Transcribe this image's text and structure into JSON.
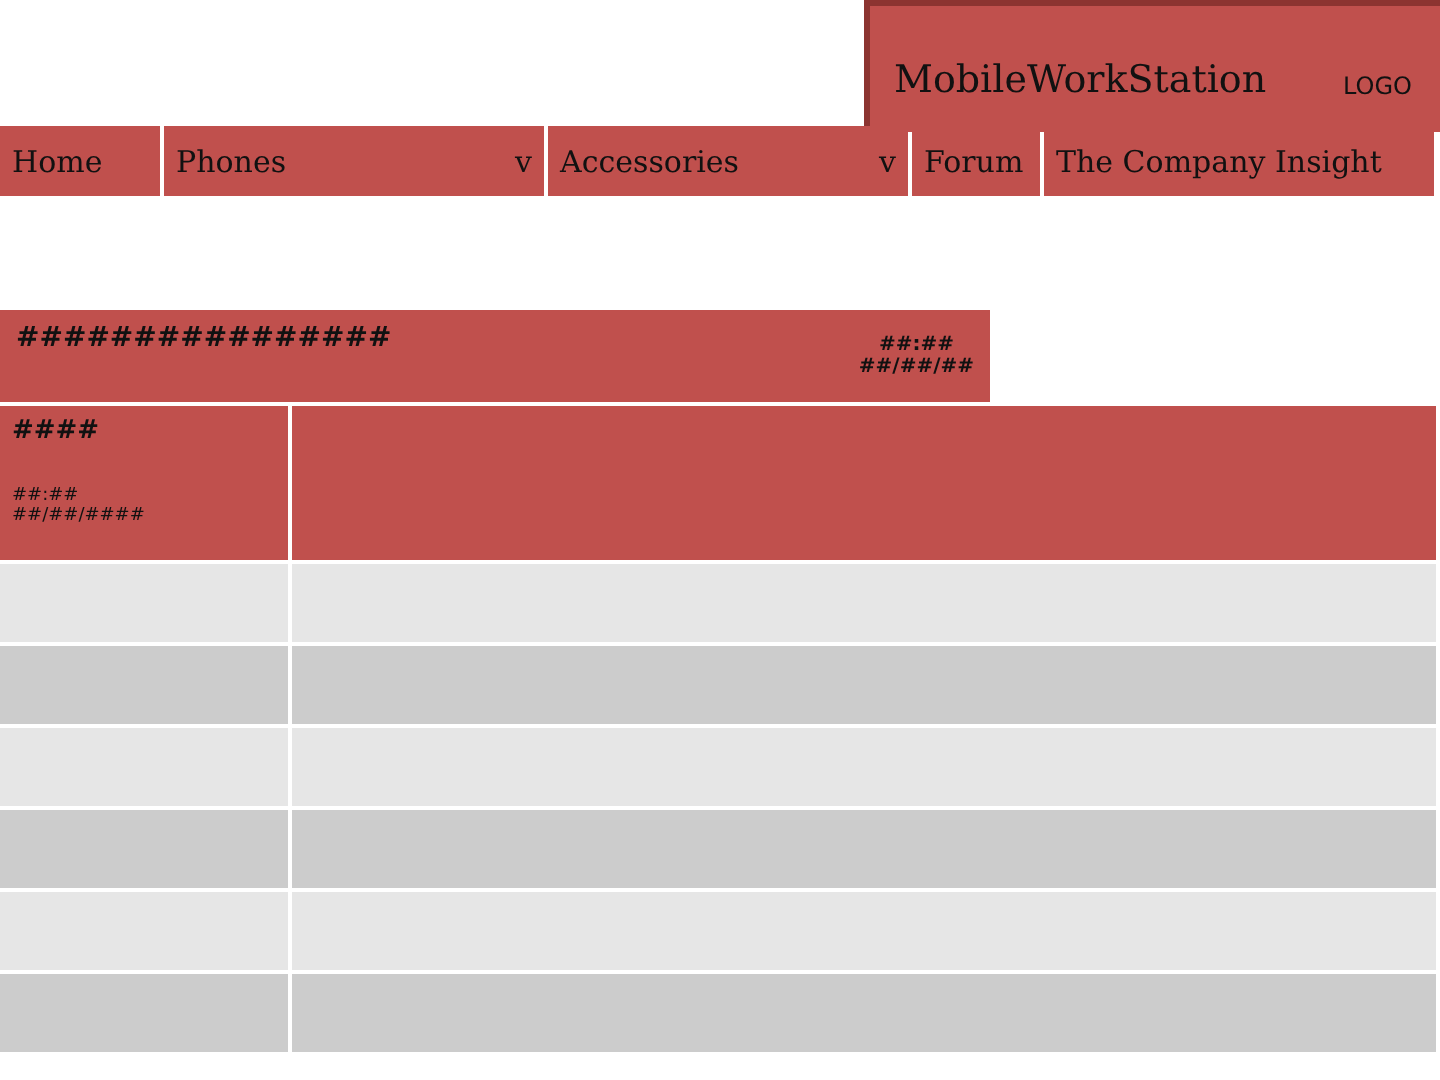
{
  "header": {
    "title": "MobileWorkStation",
    "logo": "LOGO"
  },
  "nav": [
    {
      "label": "Home"
    },
    {
      "label": "Phones",
      "caret": "v"
    },
    {
      "label": "Accessories",
      "caret": "v"
    },
    {
      "label": "Forum"
    },
    {
      "label": "The Company Insight"
    }
  ],
  "banner": {
    "title": "################",
    "time": "##:##",
    "date": "##/##/##"
  },
  "feature": {
    "title": "####",
    "time": "##:##",
    "date": "##/##/####"
  },
  "rows": [
    {
      "kind": "light"
    },
    {
      "kind": "dark"
    },
    {
      "kind": "light"
    },
    {
      "kind": "dark"
    },
    {
      "kind": "light"
    },
    {
      "kind": "dark"
    }
  ]
}
